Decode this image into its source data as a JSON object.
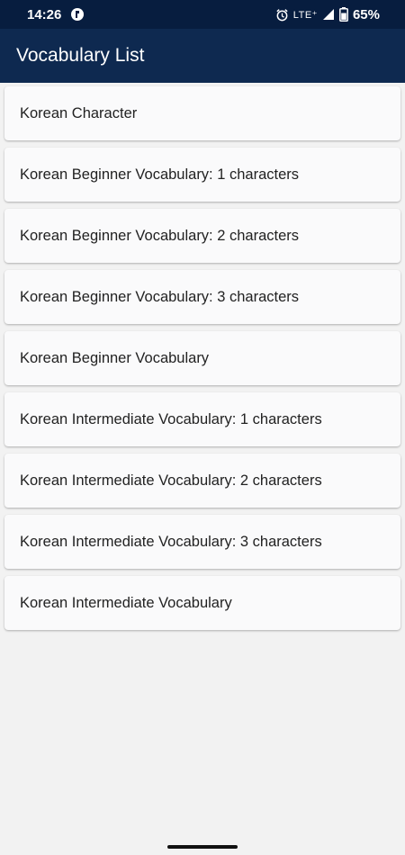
{
  "status_bar": {
    "time": "14:26",
    "network": "LTE⁺",
    "battery": "65%"
  },
  "app_bar": {
    "title": "Vocabulary List"
  },
  "vocab_list": {
    "items": [
      {
        "label": "Korean Character"
      },
      {
        "label": "Korean Beginner Vocabulary: 1 characters"
      },
      {
        "label": "Korean Beginner Vocabulary: 2 characters"
      },
      {
        "label": "Korean Beginner Vocabulary: 3 characters"
      },
      {
        "label": "Korean Beginner Vocabulary"
      },
      {
        "label": "Korean Intermediate Vocabulary: 1 characters"
      },
      {
        "label": "Korean Intermediate Vocabulary: 2 characters"
      },
      {
        "label": "Korean Intermediate Vocabulary: 3 characters"
      },
      {
        "label": "Korean Intermediate Vocabulary"
      }
    ]
  },
  "colors": {
    "status_bar_bg": "#071d3f",
    "app_bar_bg": "#0e2950",
    "page_bg": "#f2f2f2",
    "card_bg": "#fafafb"
  },
  "icons": [
    "app-notification-icon",
    "alarm-icon",
    "signal-icon",
    "battery-icon"
  ]
}
